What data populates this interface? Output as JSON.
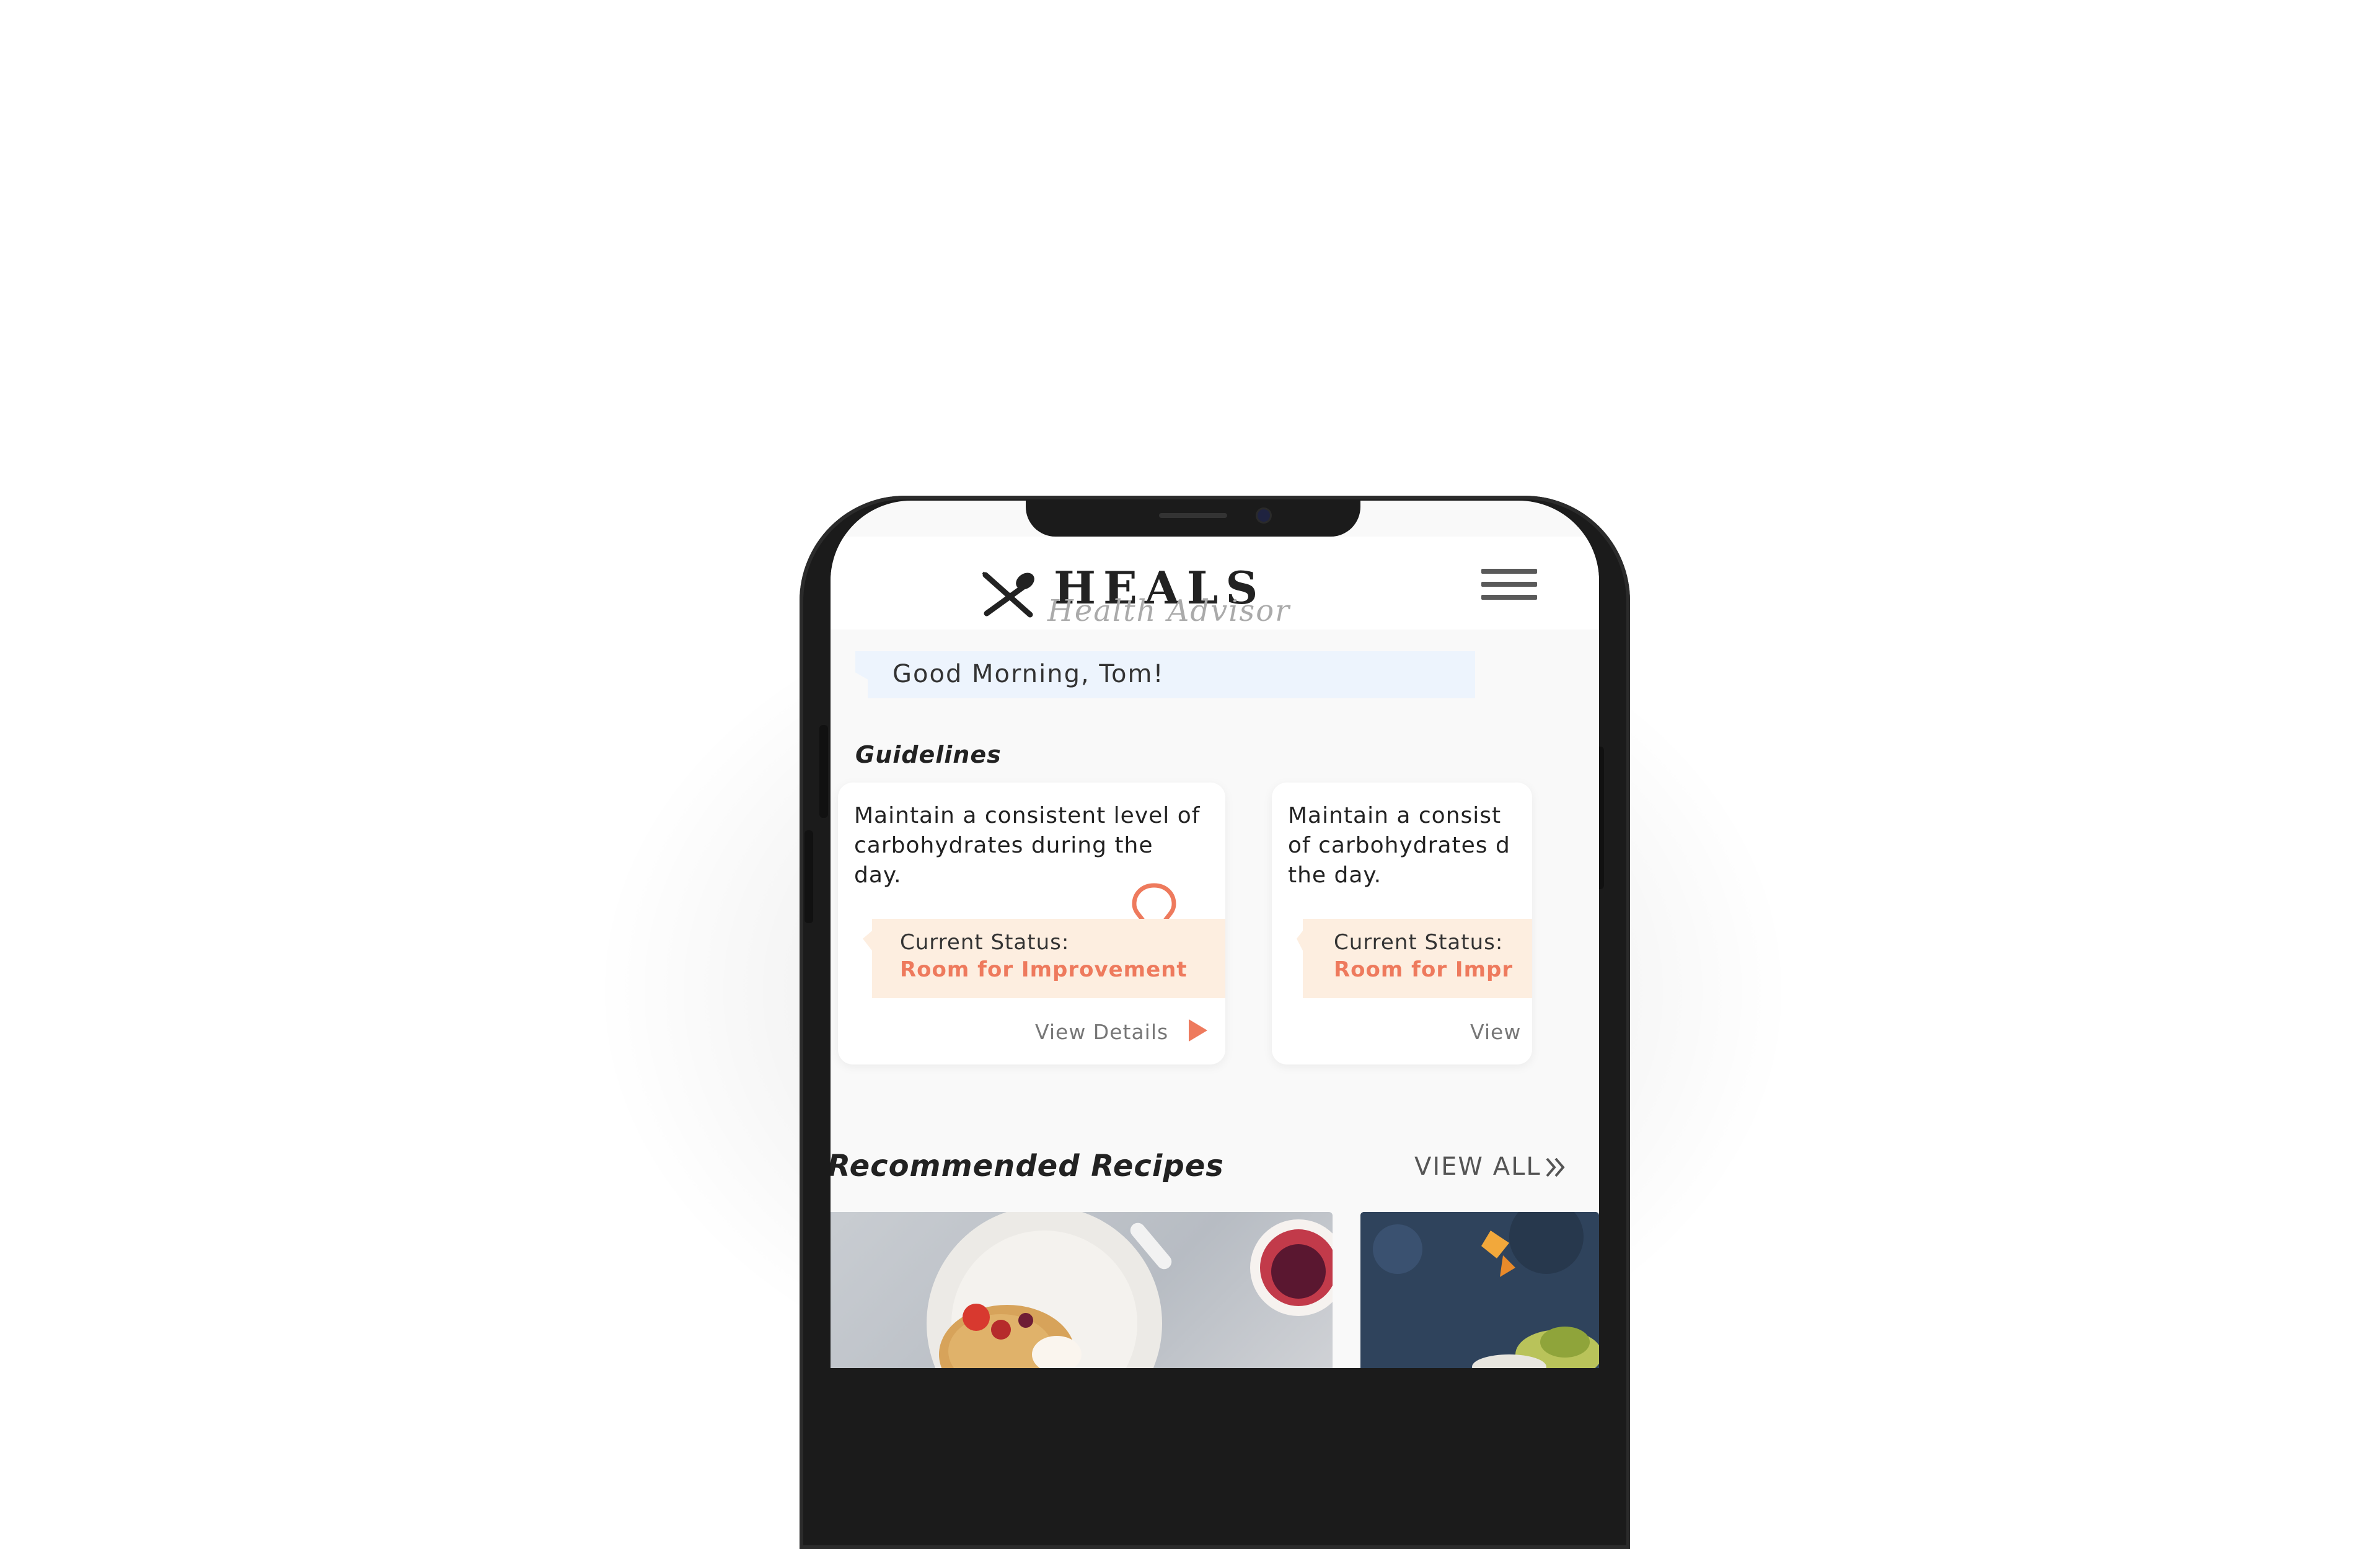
{
  "app": {
    "logo_text": "HEALS",
    "logo_subtitle": "Health Advisor"
  },
  "greeting": "Good Morning, Tom!",
  "guidelines": {
    "title": "Guidelines",
    "cards": [
      {
        "text": "Maintain a consistent level of carbohydrates during the day.",
        "status_label": "Current Status:",
        "status_value": "Room for Improvement",
        "details_label": "View Details"
      },
      {
        "text": "Maintain a consist of carbohydrates d the day.",
        "status_label": "Current Status:",
        "status_value": "Room for Impr",
        "details_label": "View"
      }
    ]
  },
  "recipes": {
    "title": "Recommended Recipes",
    "view_all_label": "VIEW ALL",
    "items": [
      {
        "image": "pancakes-with-berries"
      },
      {
        "image": "dark-stone-dish"
      }
    ]
  },
  "colors": {
    "accent": "#EE7A5D",
    "status_bg": "#FDEEE0",
    "greeting_bg": "#EDF4FD",
    "screen_bg": "#F9F9F9"
  },
  "icons": [
    "fork-spoon-icon",
    "hamburger-menu-icon",
    "lightbulb-icon",
    "play-arrow-icon",
    "double-chevron-right-icon"
  ]
}
